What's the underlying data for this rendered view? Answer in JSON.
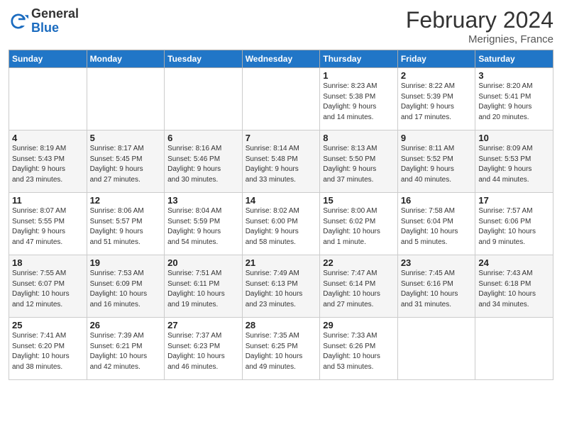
{
  "header": {
    "logo_general": "General",
    "logo_blue": "Blue",
    "month_year": "February 2024",
    "location": "Merignies, France"
  },
  "days_of_week": [
    "Sunday",
    "Monday",
    "Tuesday",
    "Wednesday",
    "Thursday",
    "Friday",
    "Saturday"
  ],
  "weeks": [
    [
      {
        "day": "",
        "info": ""
      },
      {
        "day": "",
        "info": ""
      },
      {
        "day": "",
        "info": ""
      },
      {
        "day": "",
        "info": ""
      },
      {
        "day": "1",
        "info": "Sunrise: 8:23 AM\nSunset: 5:38 PM\nDaylight: 9 hours\nand 14 minutes."
      },
      {
        "day": "2",
        "info": "Sunrise: 8:22 AM\nSunset: 5:39 PM\nDaylight: 9 hours\nand 17 minutes."
      },
      {
        "day": "3",
        "info": "Sunrise: 8:20 AM\nSunset: 5:41 PM\nDaylight: 9 hours\nand 20 minutes."
      }
    ],
    [
      {
        "day": "4",
        "info": "Sunrise: 8:19 AM\nSunset: 5:43 PM\nDaylight: 9 hours\nand 23 minutes."
      },
      {
        "day": "5",
        "info": "Sunrise: 8:17 AM\nSunset: 5:45 PM\nDaylight: 9 hours\nand 27 minutes."
      },
      {
        "day": "6",
        "info": "Sunrise: 8:16 AM\nSunset: 5:46 PM\nDaylight: 9 hours\nand 30 minutes."
      },
      {
        "day": "7",
        "info": "Sunrise: 8:14 AM\nSunset: 5:48 PM\nDaylight: 9 hours\nand 33 minutes."
      },
      {
        "day": "8",
        "info": "Sunrise: 8:13 AM\nSunset: 5:50 PM\nDaylight: 9 hours\nand 37 minutes."
      },
      {
        "day": "9",
        "info": "Sunrise: 8:11 AM\nSunset: 5:52 PM\nDaylight: 9 hours\nand 40 minutes."
      },
      {
        "day": "10",
        "info": "Sunrise: 8:09 AM\nSunset: 5:53 PM\nDaylight: 9 hours\nand 44 minutes."
      }
    ],
    [
      {
        "day": "11",
        "info": "Sunrise: 8:07 AM\nSunset: 5:55 PM\nDaylight: 9 hours\nand 47 minutes."
      },
      {
        "day": "12",
        "info": "Sunrise: 8:06 AM\nSunset: 5:57 PM\nDaylight: 9 hours\nand 51 minutes."
      },
      {
        "day": "13",
        "info": "Sunrise: 8:04 AM\nSunset: 5:59 PM\nDaylight: 9 hours\nand 54 minutes."
      },
      {
        "day": "14",
        "info": "Sunrise: 8:02 AM\nSunset: 6:00 PM\nDaylight: 9 hours\nand 58 minutes."
      },
      {
        "day": "15",
        "info": "Sunrise: 8:00 AM\nSunset: 6:02 PM\nDaylight: 10 hours\nand 1 minute."
      },
      {
        "day": "16",
        "info": "Sunrise: 7:58 AM\nSunset: 6:04 PM\nDaylight: 10 hours\nand 5 minutes."
      },
      {
        "day": "17",
        "info": "Sunrise: 7:57 AM\nSunset: 6:06 PM\nDaylight: 10 hours\nand 9 minutes."
      }
    ],
    [
      {
        "day": "18",
        "info": "Sunrise: 7:55 AM\nSunset: 6:07 PM\nDaylight: 10 hours\nand 12 minutes."
      },
      {
        "day": "19",
        "info": "Sunrise: 7:53 AM\nSunset: 6:09 PM\nDaylight: 10 hours\nand 16 minutes."
      },
      {
        "day": "20",
        "info": "Sunrise: 7:51 AM\nSunset: 6:11 PM\nDaylight: 10 hours\nand 19 minutes."
      },
      {
        "day": "21",
        "info": "Sunrise: 7:49 AM\nSunset: 6:13 PM\nDaylight: 10 hours\nand 23 minutes."
      },
      {
        "day": "22",
        "info": "Sunrise: 7:47 AM\nSunset: 6:14 PM\nDaylight: 10 hours\nand 27 minutes."
      },
      {
        "day": "23",
        "info": "Sunrise: 7:45 AM\nSunset: 6:16 PM\nDaylight: 10 hours\nand 31 minutes."
      },
      {
        "day": "24",
        "info": "Sunrise: 7:43 AM\nSunset: 6:18 PM\nDaylight: 10 hours\nand 34 minutes."
      }
    ],
    [
      {
        "day": "25",
        "info": "Sunrise: 7:41 AM\nSunset: 6:20 PM\nDaylight: 10 hours\nand 38 minutes."
      },
      {
        "day": "26",
        "info": "Sunrise: 7:39 AM\nSunset: 6:21 PM\nDaylight: 10 hours\nand 42 minutes."
      },
      {
        "day": "27",
        "info": "Sunrise: 7:37 AM\nSunset: 6:23 PM\nDaylight: 10 hours\nand 46 minutes."
      },
      {
        "day": "28",
        "info": "Sunrise: 7:35 AM\nSunset: 6:25 PM\nDaylight: 10 hours\nand 49 minutes."
      },
      {
        "day": "29",
        "info": "Sunrise: 7:33 AM\nSunset: 6:26 PM\nDaylight: 10 hours\nand 53 minutes."
      },
      {
        "day": "",
        "info": ""
      },
      {
        "day": "",
        "info": ""
      }
    ]
  ]
}
